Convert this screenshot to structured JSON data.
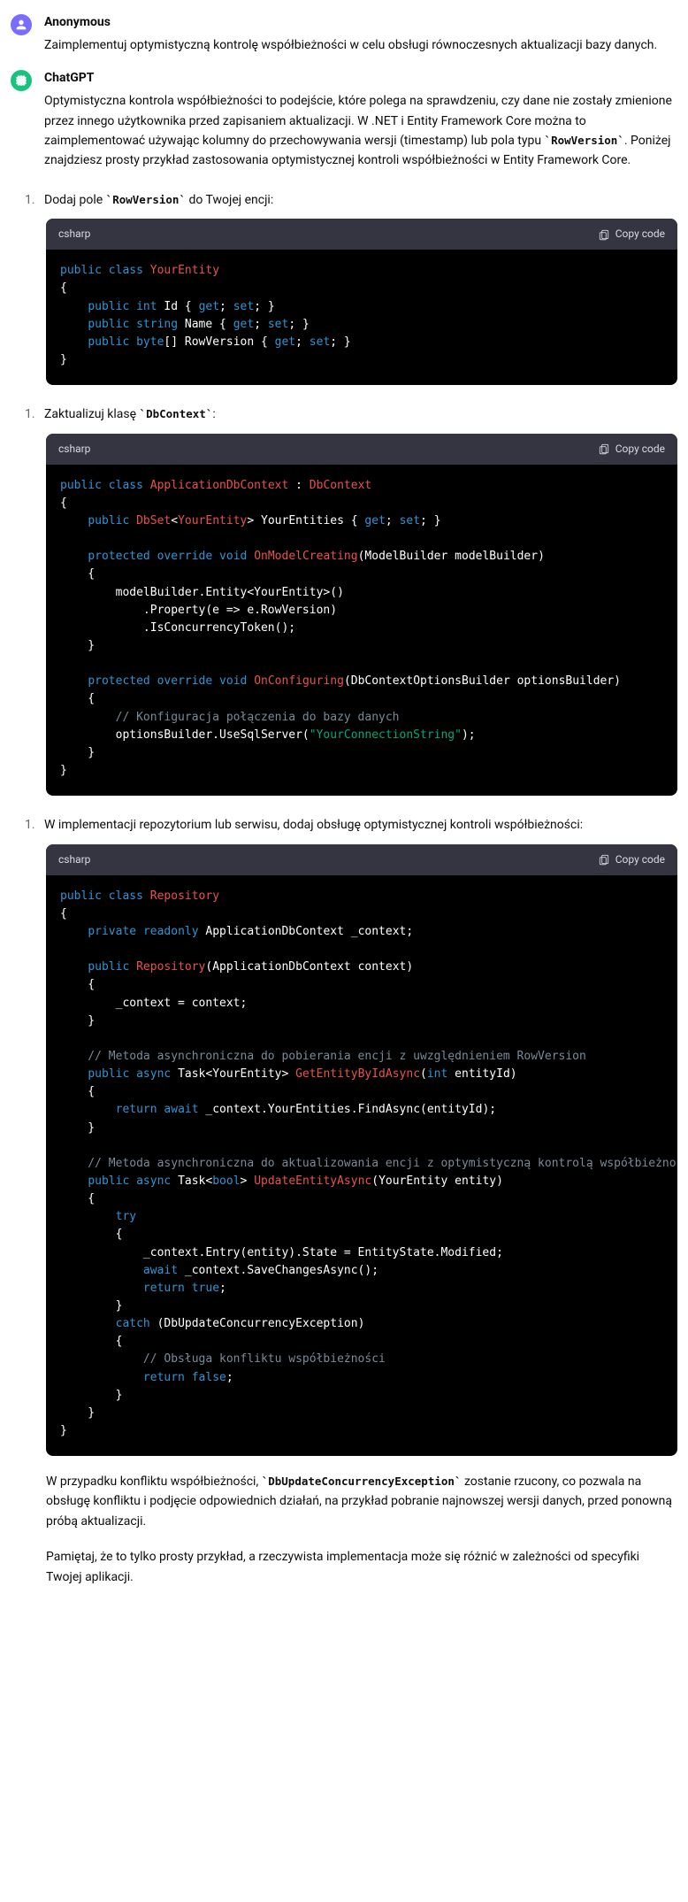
{
  "authors": {
    "user": "Anonymous",
    "assistant": "ChatGPT"
  },
  "user_message": "Zaimplementuj optymistyczną kontrolę współbieżności w celu obsługi równoczesnych aktualizacji bazy danych.",
  "intro": {
    "pre": "Optymistyczna kontrola współbieżności to podejście, które polega na sprawdzeniu, czy dane nie zostały zmienione przez innego użytkownika przed zapisaniem aktualizacji. W .NET i Entity Framework Core można to zaimplementować używając kolumny do przechowywania wersji (timestamp) lub pola typu ",
    "code": "RowVersion",
    "post": ". Poniżej znajdziesz prosty przykład zastosowania optymistycznej kontroli współbieżności w Entity Framework Core."
  },
  "steps": {
    "s1": {
      "num": "1.",
      "pre": "Dodaj pole ",
      "code": "RowVersion",
      "post": " do Twojej encji:"
    },
    "s2": {
      "num": "1.",
      "pre": "Zaktualizuj klasę ",
      "code": "DbContext",
      "post": ":"
    },
    "s3": {
      "num": "1.",
      "text": "W implementacji repozytorium lub serwisu, dodaj obsługę optymistycznej kontroli współbieżności:"
    }
  },
  "code": {
    "lang": "csharp",
    "copy": "Copy code",
    "b1": {
      "l1a": "public",
      "l1b": "class",
      "l1c": "YourEntity",
      "l2": "{",
      "l3a": "public",
      "l3b": "int",
      "l3c": " Id { ",
      "l3d": "get",
      "l3e": "; ",
      "l3f": "set",
      "l3g": "; }",
      "l4a": "public",
      "l4b": "string",
      "l4c": " Name { ",
      "l4d": "get",
      "l4e": "; ",
      "l4f": "set",
      "l4g": "; }",
      "l5a": "public",
      "l5b": "byte",
      "l5c": "[] RowVersion { ",
      "l5d": "get",
      "l5e": "; ",
      "l5f": "set",
      "l5g": "; }",
      "l6": "}"
    },
    "b2": {
      "l1a": "public",
      "l1b": "class",
      "l1c": "ApplicationDbContext",
      "l1d": " : ",
      "l1e": "DbContext",
      "l2": "{",
      "l3a": "public",
      "l3b": "DbSet",
      "l3c": "<",
      "l3d": "YourEntity",
      "l3e": "> YourEntities { ",
      "l3f": "get",
      "l3g": "; ",
      "l3h": "set",
      "l3i": "; }",
      "l5a": "protected",
      "l5b": "override",
      "l5c": "void",
      "l5d": "OnModelCreating",
      "l5e": "(ModelBuilder modelBuilder)",
      "l6": "    {",
      "l7": "        modelBuilder.Entity<YourEntity>()",
      "l8": "            .Property(e => e.RowVersion)",
      "l9": "            .IsConcurrencyToken();",
      "l10": "    }",
      "l12a": "protected",
      "l12b": "override",
      "l12c": "void",
      "l12d": "OnConfiguring",
      "l12e": "(DbContextOptionsBuilder optionsBuilder)",
      "l13": "    {",
      "l14": "        // Konfiguracja połączenia do bazy danych",
      "l15a": "        optionsBuilder.UseSqlServer(",
      "l15b": "\"YourConnectionString\"",
      "l15c": ");",
      "l16": "    }",
      "l17": "}"
    },
    "b3": {
      "l1a": "public",
      "l1b": "class",
      "l1c": "Repository",
      "l2": "{",
      "l3a": "private",
      "l3b": "readonly",
      "l3c": " ApplicationDbContext _context;",
      "l5a": "public",
      "l5b": "Repository",
      "l5c": "(ApplicationDbContext context)",
      "l6": "    {",
      "l7": "        _context = context;",
      "l8": "    }",
      "l10": "    // Metoda asynchroniczna do pobierania encji z uwzględnieniem RowVersion",
      "l11a": "public",
      "l11b": "async",
      "l11c": " Task<YourEntity> ",
      "l11d": "GetEntityByIdAsync",
      "l11e": "(",
      "l11f": "int",
      "l11g": " entityId)",
      "l12": "    {",
      "l13a": "return",
      "l13b": "await",
      "l13c": " _context.YourEntities.FindAsync(entityId);",
      "l14": "    }",
      "l16": "    // Metoda asynchroniczna do aktualizowania encji z optymistyczną kontrolą współbieżności",
      "l17a": "public",
      "l17b": "async",
      "l17c": " Task<",
      "l17d": "bool",
      "l17e": "> ",
      "l17f": "UpdateEntityAsync",
      "l17g": "(YourEntity entity)",
      "l18": "    {",
      "l19": "try",
      "l20": "        {",
      "l21": "            _context.Entry(entity).State = EntityState.Modified;",
      "l22a": "await",
      "l22b": " _context.SaveChangesAsync();",
      "l23a": "return",
      "l23b": "true",
      "l23c": ";",
      "l24": "        }",
      "l25a": "catch",
      "l25b": " (DbUpdateConcurrencyException)",
      "l26": "        {",
      "l27": "            // Obsługa konfliktu współbieżności",
      "l28a": "return",
      "l28b": "false",
      "l28c": ";",
      "l29": "        }",
      "l30": "    }",
      "l31": "}"
    }
  },
  "outro1": {
    "pre": "W przypadku konfliktu współbieżności, ",
    "code": "DbUpdateConcurrencyException",
    "post": " zostanie rzucony, co pozwala na obsługę konfliktu i podjęcie odpowiednich działań, na przykład pobranie najnowszej wersji danych, przed ponowną próbą aktualizacji."
  },
  "outro2": "Pamiętaj, że to tylko prosty przykład, a rzeczywista implementacja może się różnić w zależności od specyfiki Twojej aplikacji."
}
